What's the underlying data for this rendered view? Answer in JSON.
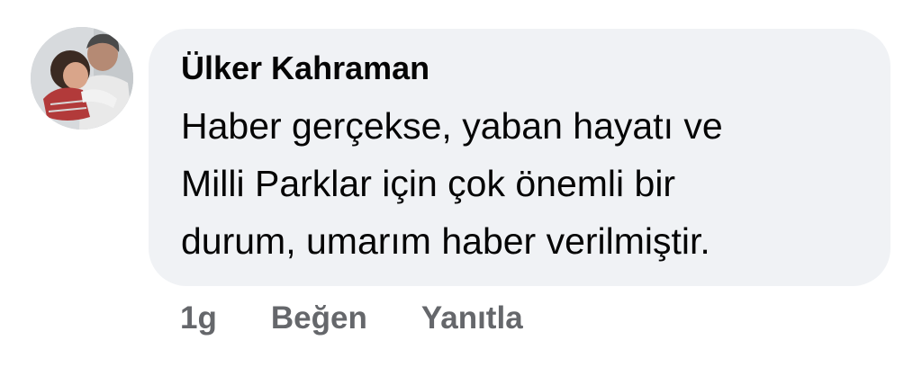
{
  "comment": {
    "author": "Ülker Kahraman",
    "lines": [
      "Haber gerçekse, yaban hayatı ve",
      "Milli Parklar için çok önemli bir",
      "durum, umarım haber verilmiştir."
    ],
    "timestamp": "1g",
    "like_label": "Beğen",
    "reply_label": "Yanıtla",
    "avatar_icon": "profile-photo-icon"
  },
  "colors": {
    "bubble": "#f0f2f5",
    "text": "#050505",
    "secondary": "#65676b"
  }
}
